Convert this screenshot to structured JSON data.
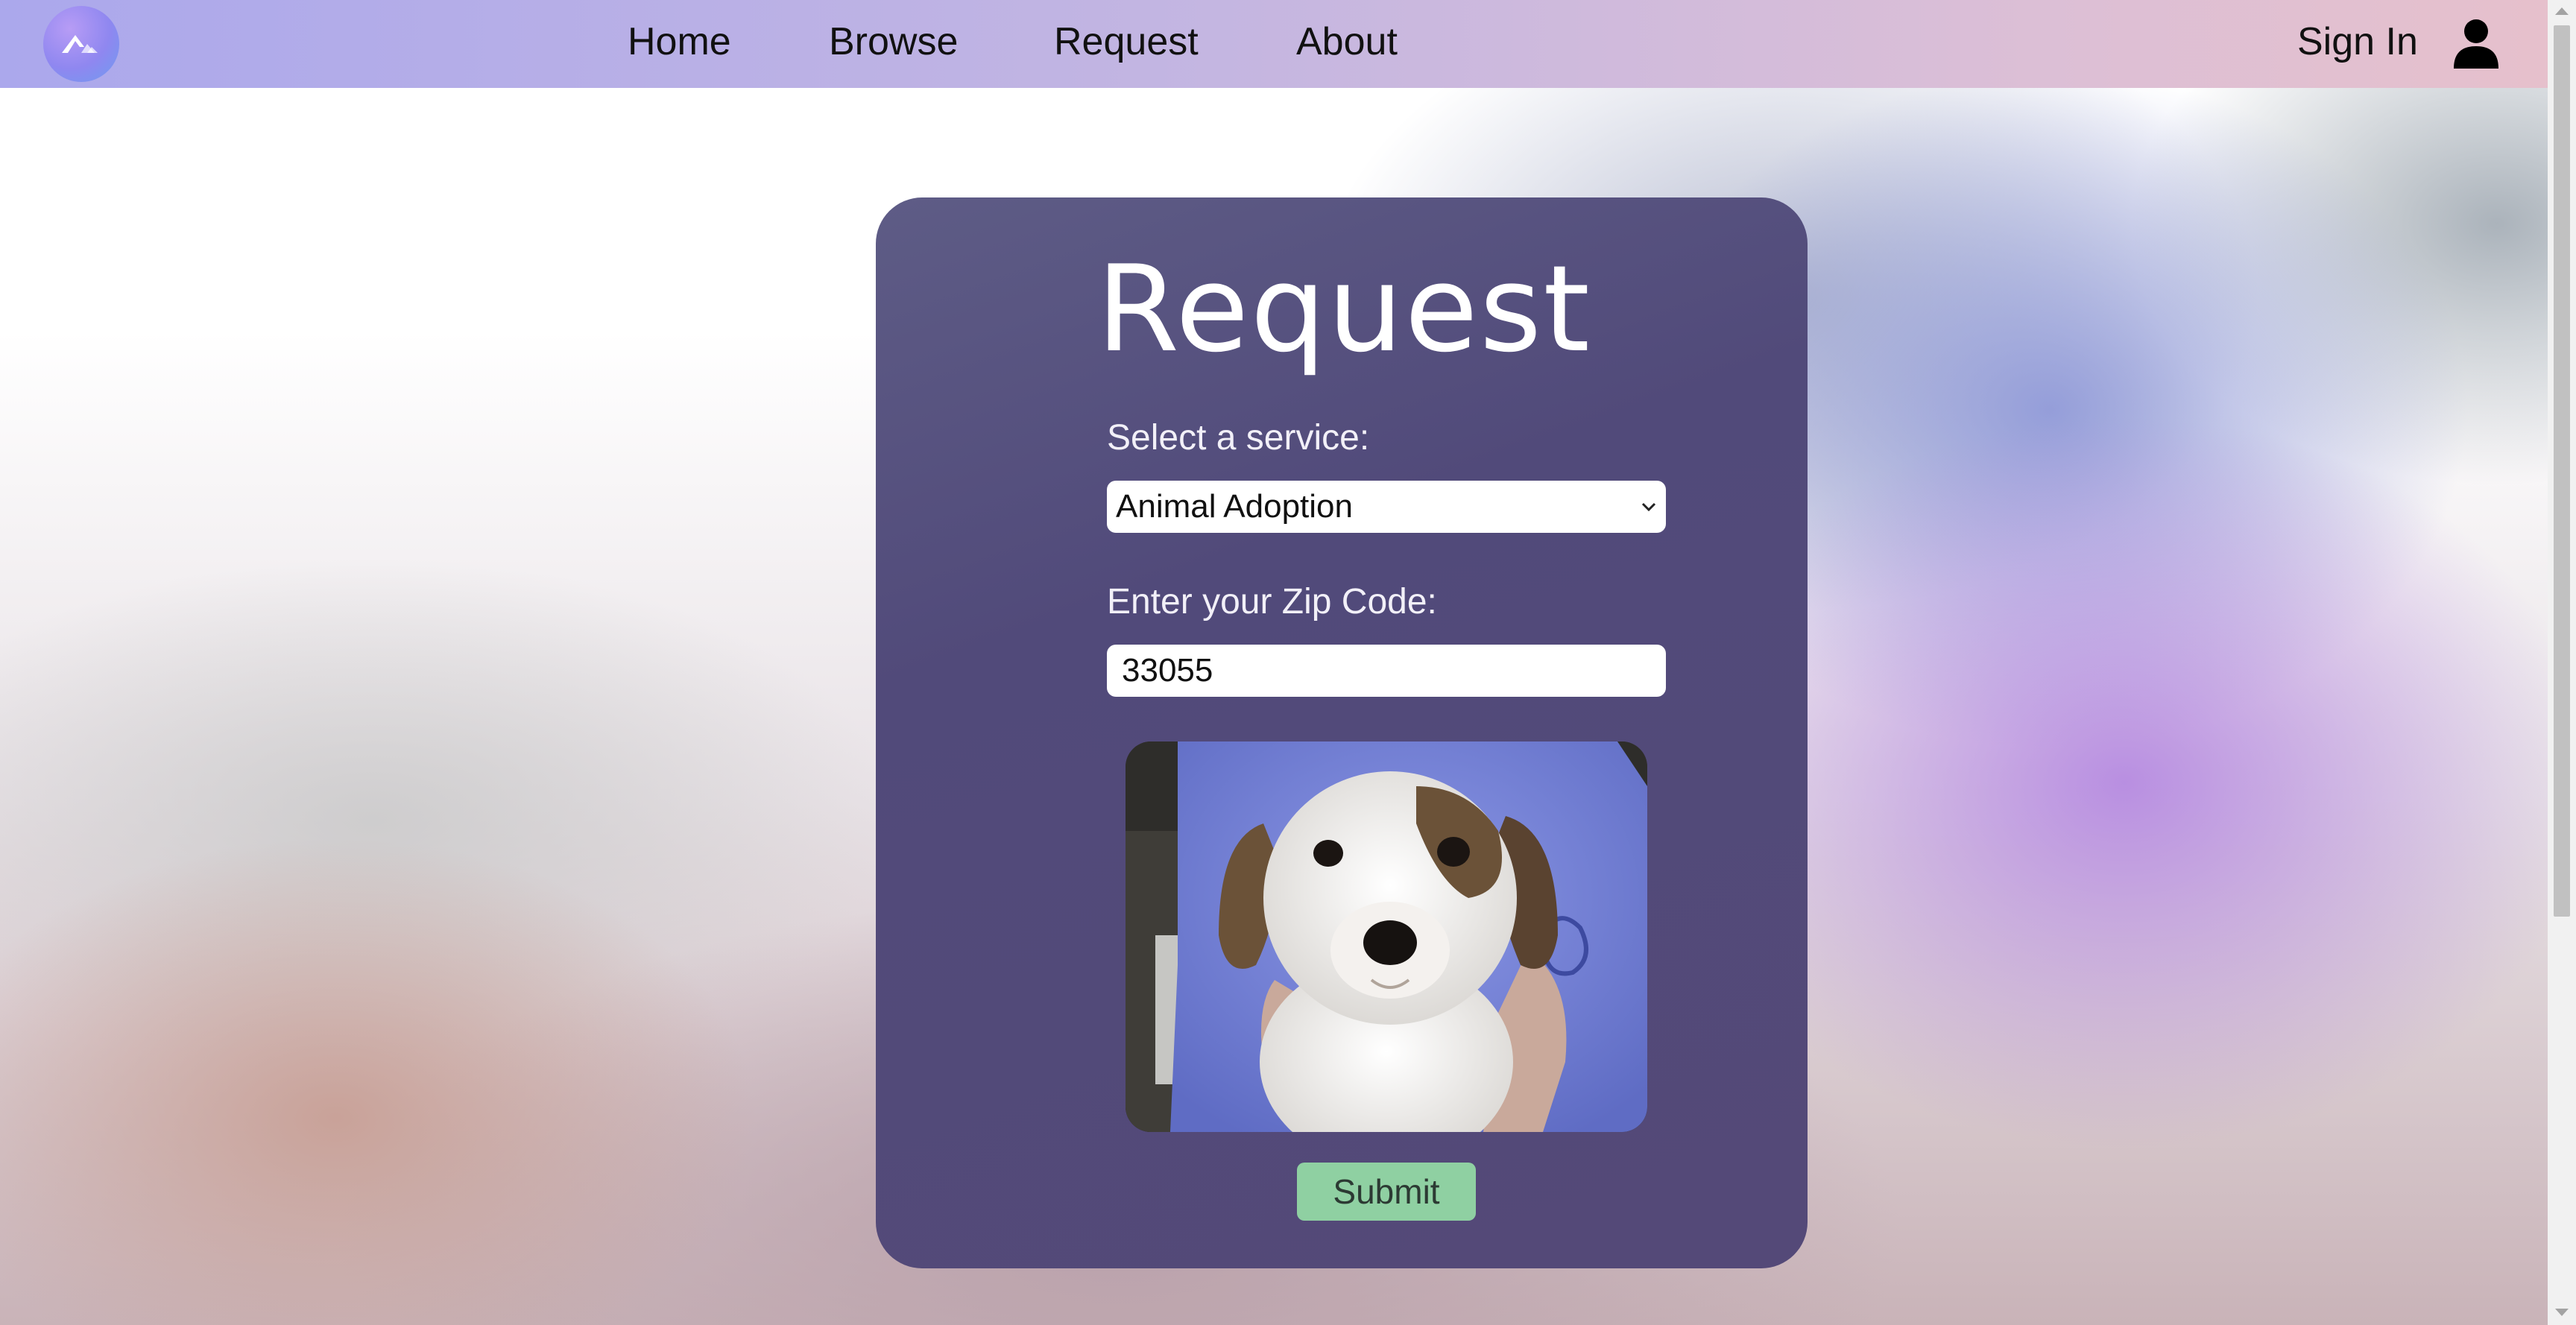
{
  "header": {
    "logo_icon": "mountain-logo-icon",
    "nav": [
      {
        "label": "Home"
      },
      {
        "label": "Browse"
      },
      {
        "label": "Request"
      },
      {
        "label": "About"
      }
    ],
    "sign_in_label": "Sign In",
    "user_icon": "user-icon"
  },
  "form": {
    "title": "Request",
    "service_label": "Select a service:",
    "service_value": "Animal Adoption",
    "zip_label": "Enter your Zip Code:",
    "zip_value": "33055",
    "submit_label": "Submit"
  },
  "colors": {
    "card_bg": "#524a7a",
    "submit_bg": "#8fd0a2",
    "header_start": "#aba8ec",
    "header_end": "#e6c0cc"
  }
}
